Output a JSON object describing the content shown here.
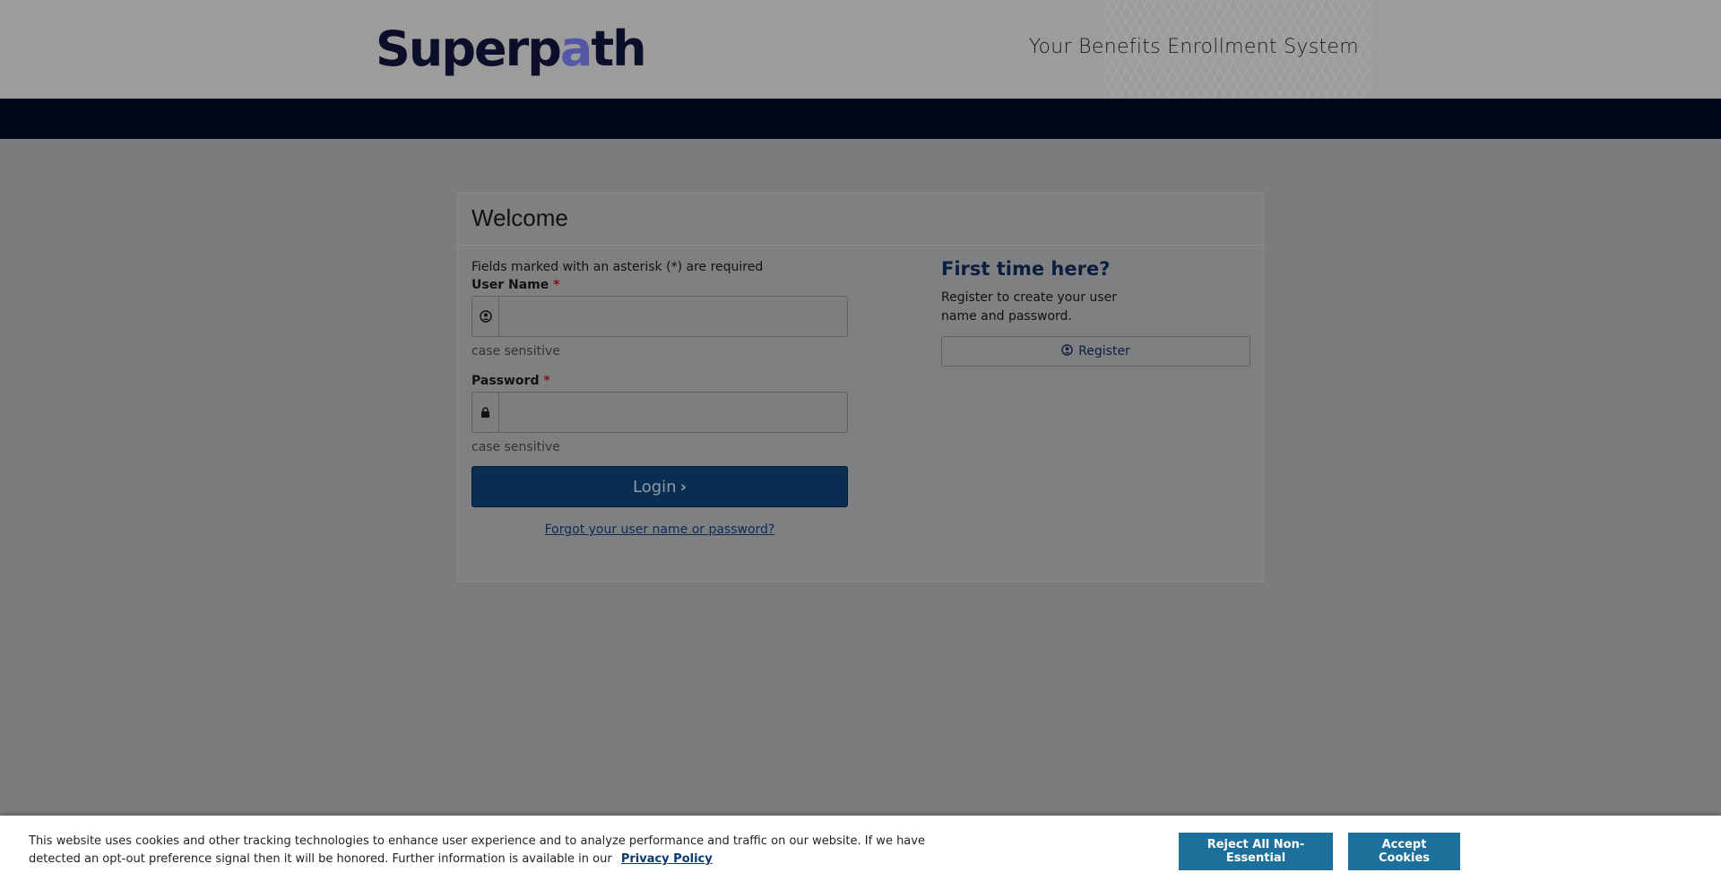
{
  "header": {
    "logo_pre": "Superp",
    "logo_accent": "a",
    "logo_post": "th",
    "tagline": "Your Benefits Enrollment System"
  },
  "card": {
    "title": "Welcome",
    "required_note": "Fields marked with an asterisk (*) are required",
    "username": {
      "label": "User Name",
      "required_mark": "*",
      "value": "",
      "help": "case sensitive",
      "icon": "user-circle-icon"
    },
    "password": {
      "label": "Password",
      "required_mark": "*",
      "value": "",
      "help": "case sensitive",
      "icon": "lock-icon"
    },
    "login_label": "Login",
    "forgot_label": "Forgot your user name or password?",
    "first_time": {
      "title": "First time here?",
      "text": "Register to create your user name and password.",
      "register_label": "Register",
      "register_icon": "user-circle-icon"
    }
  },
  "cookie_banner": {
    "text": "This website uses cookies and other tracking technologies to enhance user experience and to analyze performance and traffic on our website. If we have detected an opt-out preference signal then it will be honored. Further information is available in our",
    "privacy_link": "Privacy Policy",
    "reject_label": "Reject All Non-Essential",
    "accept_label": "Accept Cookies"
  },
  "colors": {
    "navbar": "#020817",
    "login_button": "#0a2d52",
    "cookie_button": "#1d6f9c",
    "logo_accent": "#5457a8"
  }
}
